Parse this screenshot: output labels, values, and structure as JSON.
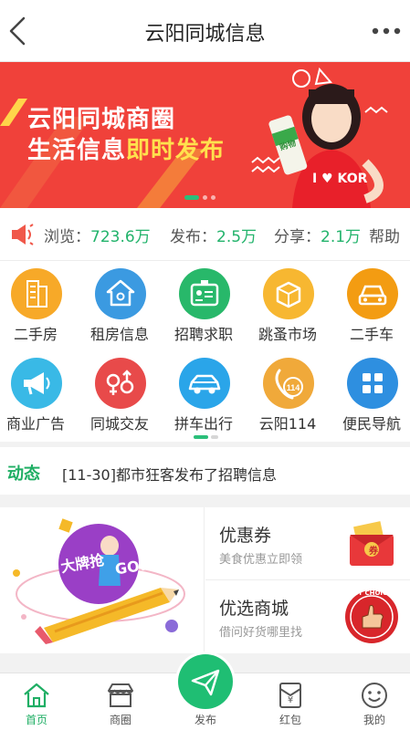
{
  "header": {
    "title": "云阳同城信息",
    "back_icon": "chevron-left-icon",
    "more_icon": "more-dots-icon"
  },
  "banner": {
    "line1": "云阳同城商圈",
    "line2_main": "生活信息",
    "line2_highlight": "即时发布",
    "shirt_text": "I ♥ KOR",
    "bag_text": "购物",
    "slides": 3,
    "active_slide": 1,
    "colors": {
      "background": "#f0413a",
      "highlight": "#ffe14d"
    }
  },
  "stats": {
    "views_label": "浏览：",
    "views_value": "723.6万",
    "posts_label": "发布：",
    "posts_value": "2.5万",
    "shares_label": "分享：",
    "shares_value": "2.1万",
    "help_label": "帮助",
    "accent": "#22b36b"
  },
  "categories": [
    {
      "label": "二手房",
      "icon": "building-icon",
      "color": "#f7a928"
    },
    {
      "label": "租房信息",
      "icon": "house-icon",
      "color": "#3b9ae1"
    },
    {
      "label": "招聘求职",
      "icon": "id-card-icon",
      "color": "#28b86a"
    },
    {
      "label": "跳蚤市场",
      "icon": "box-icon",
      "color": "#f7b731"
    },
    {
      "label": "二手车",
      "icon": "car-front-icon",
      "color": "#f39c12"
    },
    {
      "label": "商业广告",
      "icon": "megaphone-icon",
      "color": "#39b9e6"
    },
    {
      "label": "同城交友",
      "icon": "gender-icon",
      "color": "#e84a4a"
    },
    {
      "label": "拼车出行",
      "icon": "car-side-icon",
      "color": "#2aa5e9"
    },
    {
      "label": "云阳114",
      "icon": "phone-114-icon",
      "color": "#f0a93a"
    },
    {
      "label": "便民导航",
      "icon": "grid-icon",
      "color": "#2e8fe0"
    }
  ],
  "news": {
    "tag": "动态",
    "text": "[11-30]都市狂客发布了招聘信息"
  },
  "promo": {
    "left_badge_text": "大牌抢",
    "left_go_text": "GO!",
    "coupon": {
      "title": "优惠券",
      "subtitle": "美食优惠立即领",
      "icon": "coupon-envelope-icon",
      "icon_text": "券"
    },
    "mall": {
      "title": "优选商城",
      "subtitle": "借问好货哪里找",
      "icon": "best-choice-icon",
      "icon_text": "BEST CHOICE"
    }
  },
  "tabbar": {
    "items": [
      {
        "label": "首页",
        "icon": "home-icon",
        "active": true
      },
      {
        "label": "商圈",
        "icon": "shop-icon",
        "active": false
      },
      {
        "label": "发布",
        "icon": "send-icon",
        "active": false
      },
      {
        "label": "红包",
        "icon": "red-packet-icon",
        "active": false
      },
      {
        "label": "我的",
        "icon": "smiley-icon",
        "active": false
      }
    ],
    "red_packet_symbol": "¥",
    "accent": "#1fae64"
  }
}
